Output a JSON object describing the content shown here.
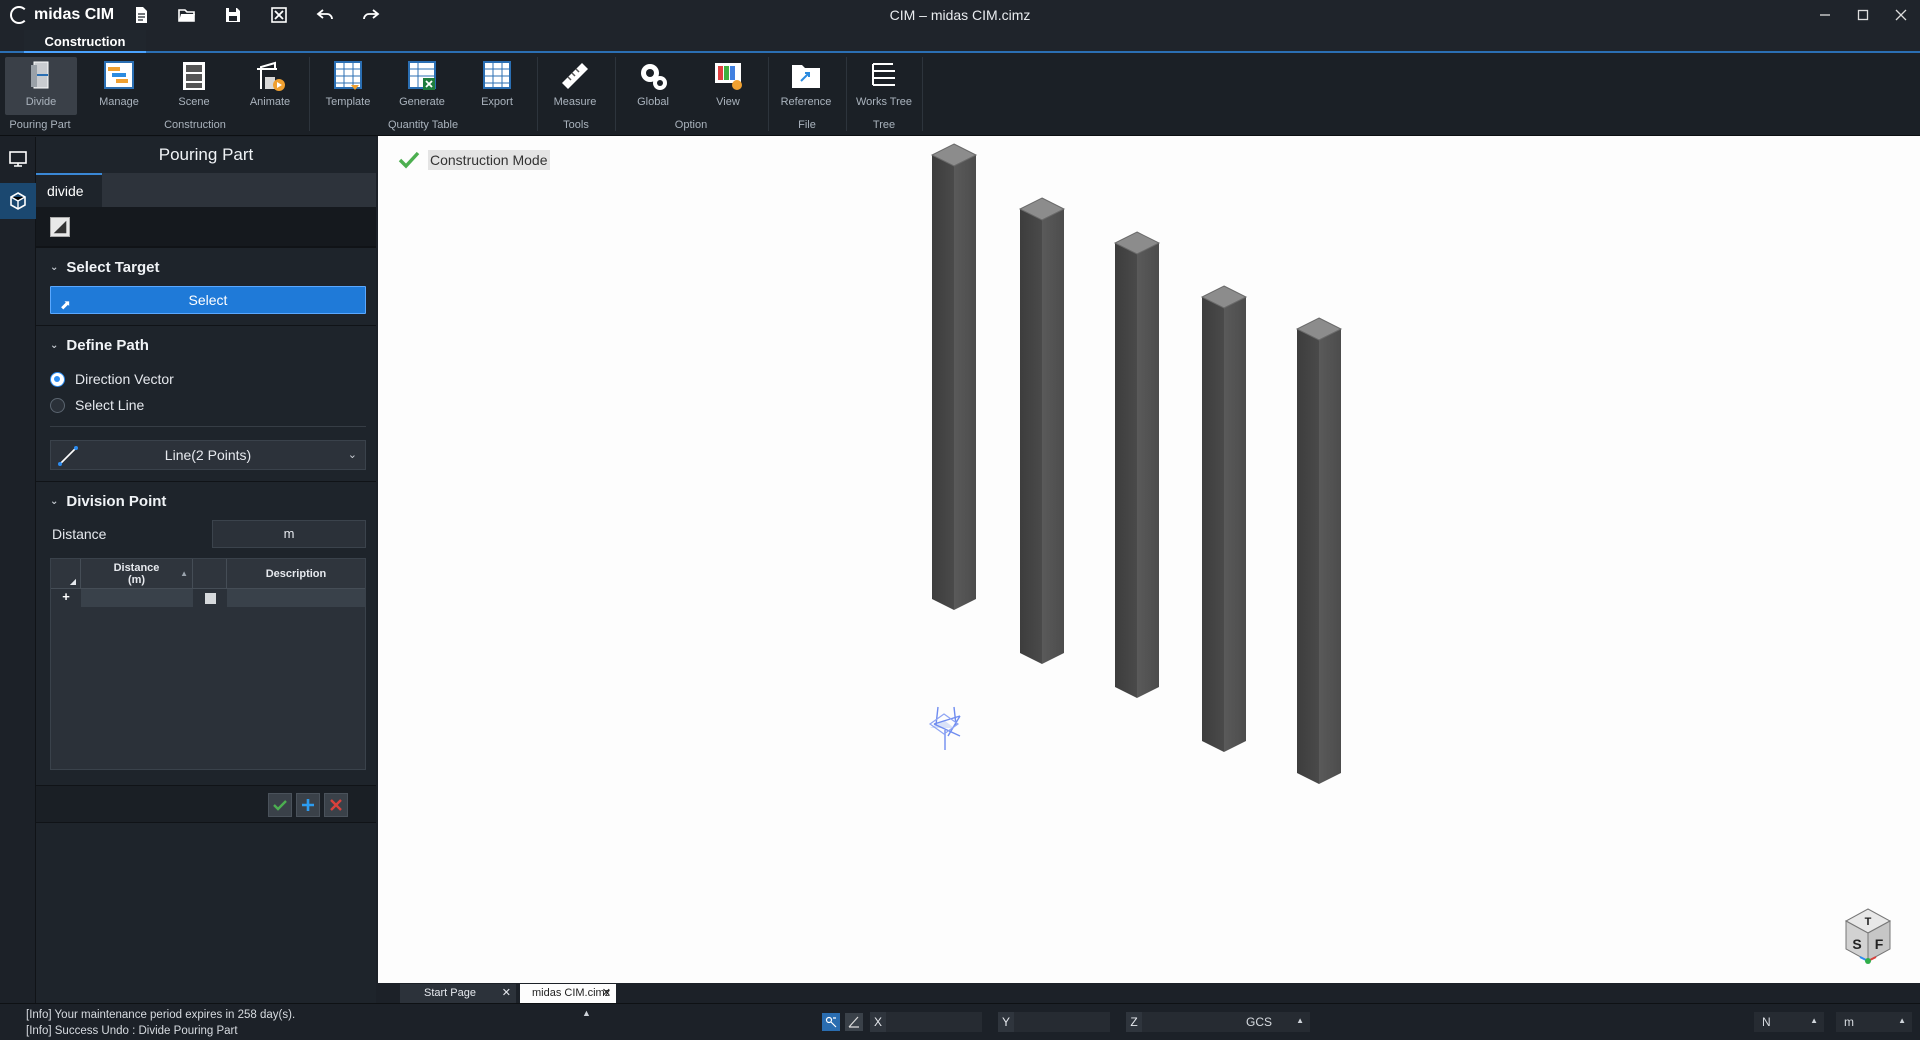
{
  "app": {
    "logo_text": "midas CIM",
    "window_title": "CIM – midas CIM.cimz"
  },
  "ribbon": {
    "active_tab": "Construction",
    "buttons": [
      {
        "id": "divide",
        "label": "Divide",
        "icon": "divide-icon"
      },
      {
        "id": "manage",
        "label": "Manage",
        "icon": "manage-icon"
      },
      {
        "id": "scene",
        "label": "Scene",
        "icon": "scene-icon"
      },
      {
        "id": "animate",
        "label": "Animate",
        "icon": "animate-icon"
      },
      {
        "id": "template",
        "label": "Template",
        "icon": "template-icon"
      },
      {
        "id": "generate",
        "label": "Generate",
        "icon": "generate-icon"
      },
      {
        "id": "export",
        "label": "Export",
        "icon": "export-icon"
      },
      {
        "id": "measure",
        "label": "Measure",
        "icon": "measure-icon"
      },
      {
        "id": "global",
        "label": "Global",
        "icon": "global-icon"
      },
      {
        "id": "view",
        "label": "View",
        "icon": "view-icon"
      },
      {
        "id": "reference",
        "label": "Reference",
        "icon": "reference-icon"
      },
      {
        "id": "works_tree",
        "label": "Works Tree",
        "icon": "works-tree-icon"
      }
    ],
    "groups": [
      "Pouring Part",
      "Construction",
      "Quantity Table",
      "Tools",
      "Option",
      "File",
      "Tree"
    ]
  },
  "panel": {
    "title": "Pouring Part",
    "tab": "divide",
    "select_target": {
      "heading": "Select Target",
      "button": "Select"
    },
    "define_path": {
      "heading": "Define Path",
      "options": [
        "Direction Vector",
        "Select Line"
      ],
      "selected": "Direction Vector",
      "line_type": "Line(2 Points)"
    },
    "division_point": {
      "heading": "Division Point",
      "distance_label": "Distance",
      "distance_unit": "m",
      "grid_headers": {
        "distance": "Distance",
        "distance_unit": "(m)",
        "description": "Description"
      },
      "new_row_marker": "+"
    }
  },
  "viewport": {
    "mode_label": "Construction Mode",
    "view_cube_faces": [
      "T",
      "S",
      "F"
    ],
    "columns": 5
  },
  "doc_tabs": [
    {
      "label": "Start Page",
      "active": false
    },
    {
      "label": "midas CIM.cimz",
      "active": true
    }
  ],
  "status": {
    "messages": [
      "[Info] Your maintenance period expires in 258 day(s).",
      "[Info] Success Undo : Divide Pouring Part"
    ],
    "axes": [
      "X",
      "Y",
      "Z"
    ],
    "coord_system": "GCS",
    "force_unit": "N",
    "length_unit": "m"
  },
  "colors": {
    "accent": "#1f7ad8",
    "check_green": "#4caf50",
    "cancel_red": "#d9413c",
    "column_gray": "#4a4a4a"
  }
}
